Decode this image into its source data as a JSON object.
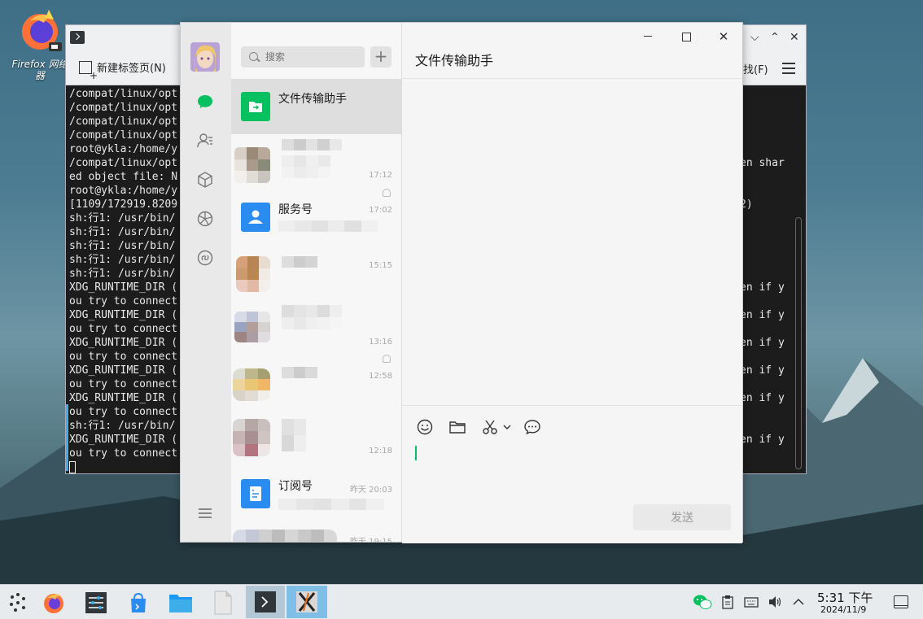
{
  "desktop": {
    "icon_label": "Firefox 网络\n器"
  },
  "terminal": {
    "new_tab_label": "新建标签页(N)",
    "find_label": "找(F)",
    "lines": [
      "/compat/linux/opt",
      "/compat/linux/opt",
      "/compat/linux/opt",
      "/compat/linux/opt",
      "root@ykla:/home/y",
      "/compat/linux/opt",
      "ed object file: N",
      "root@ykla:/home/y",
      "[1109/172919.8209",
      "sh:行1: /usr/bin/",
      "sh:行1: /usr/bin/",
      "sh:行1: /usr/bin/",
      "sh:行1: /usr/bin/",
      "sh:行1: /usr/bin/",
      "XDG_RUNTIME_DIR (",
      "ou try to connect",
      "XDG_RUNTIME_DIR (",
      "ou try to connect",
      "XDG_RUNTIME_DIR (",
      "ou try to connect",
      "XDG_RUNTIME_DIR (",
      "ou try to connect",
      "XDG_RUNTIME_DIR (",
      "ou try to connect",
      "sh:行1: /usr/bin/",
      "XDG_RUNTIME_DIR (",
      "ou try to connect"
    ],
    "right_lines": [
      "",
      "",
      "",
      "",
      "",
      "en shar",
      "",
      "",
      "2)",
      "",
      "",
      "",
      "",
      "",
      "en if y",
      "",
      "en if y",
      "",
      "en if y",
      "",
      "en if y",
      "",
      "en if y",
      "",
      "",
      "en if y",
      ""
    ]
  },
  "wechat": {
    "search_placeholder": "搜索",
    "add_label": "+",
    "chat_title": "文件传输助手",
    "send_label": "发送",
    "chats": [
      {
        "name": "文件传输助手",
        "time": ""
      },
      {
        "name": "",
        "time": "17:12"
      },
      {
        "name": "服务号",
        "time": "17:02"
      },
      {
        "name": "",
        "time": "15:15"
      },
      {
        "name": "",
        "time": "13:16"
      },
      {
        "name": "",
        "time": "12:58"
      },
      {
        "name": "",
        "time": "12:18"
      },
      {
        "name": "订阅号",
        "time": "昨天 20:03"
      },
      {
        "name": "",
        "time": "昨天 19:15"
      }
    ]
  },
  "taskbar": {
    "time": "5:31 下午",
    "date": "2024/11/9"
  },
  "colors": {
    "wechat_green": "#07c160",
    "service_blue": "#2a8cf0",
    "accent": "#3daee9"
  }
}
